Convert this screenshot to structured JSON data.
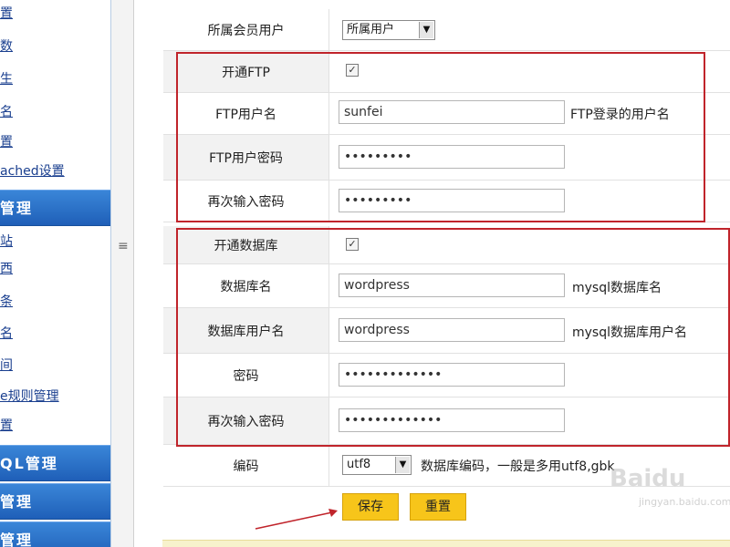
{
  "sidebar": {
    "items": [
      {
        "label": "置"
      },
      {
        "label": "数"
      },
      {
        "label": "生"
      },
      {
        "label": "名"
      },
      {
        "label": "置"
      },
      {
        "label": "ached设置"
      }
    ],
    "section1": "管理",
    "items2": [
      {
        "label": "站"
      },
      {
        "label": "西"
      },
      {
        "label": "条"
      },
      {
        "label": "名"
      },
      {
        "label": "间"
      },
      {
        "label": "e规则管理"
      },
      {
        "label": "置"
      }
    ],
    "section2": "QL管理",
    "section3": "管理",
    "section4": "管理"
  },
  "splitter": {
    "grip": "≡"
  },
  "form": {
    "member": {
      "label": "所属会员用户",
      "select": "所属用户"
    },
    "ftp_open": {
      "label": "开通FTP",
      "checked": "✓"
    },
    "ftp_user": {
      "label": "FTP用户名",
      "value": "sunfei",
      "hint": "FTP登录的用户名"
    },
    "ftp_pass": {
      "label": "FTP用户密码",
      "value": "•••••••••"
    },
    "ftp_pass2": {
      "label": "再次输入密码",
      "value": "•••••••••"
    },
    "db_open": {
      "label": "开通数据库",
      "checked": "✓"
    },
    "db_name": {
      "label": "数据库名",
      "value": "wordpress",
      "hint": "mysql数据库名"
    },
    "db_user": {
      "label": "数据库用户名",
      "value": "wordpress",
      "hint": "mysql数据库用户名"
    },
    "db_pass": {
      "label": "密码",
      "value": "•••••••••••••"
    },
    "db_pass2": {
      "label": "再次输入密码",
      "value": "•••••••••••••"
    },
    "encoding": {
      "label": "编码",
      "select": "utf8",
      "hint": "数据库编码，一般是多用utf8,gbk"
    }
  },
  "buttons": {
    "save": "保存",
    "reset": "重置"
  },
  "watermark": {
    "brand": "Baidu",
    "sub": "jingyan.baidu.com"
  },
  "colors": {
    "accent": "#c0242b",
    "button": "#f7c51a",
    "sidebar_head": "#2a6fc9"
  }
}
